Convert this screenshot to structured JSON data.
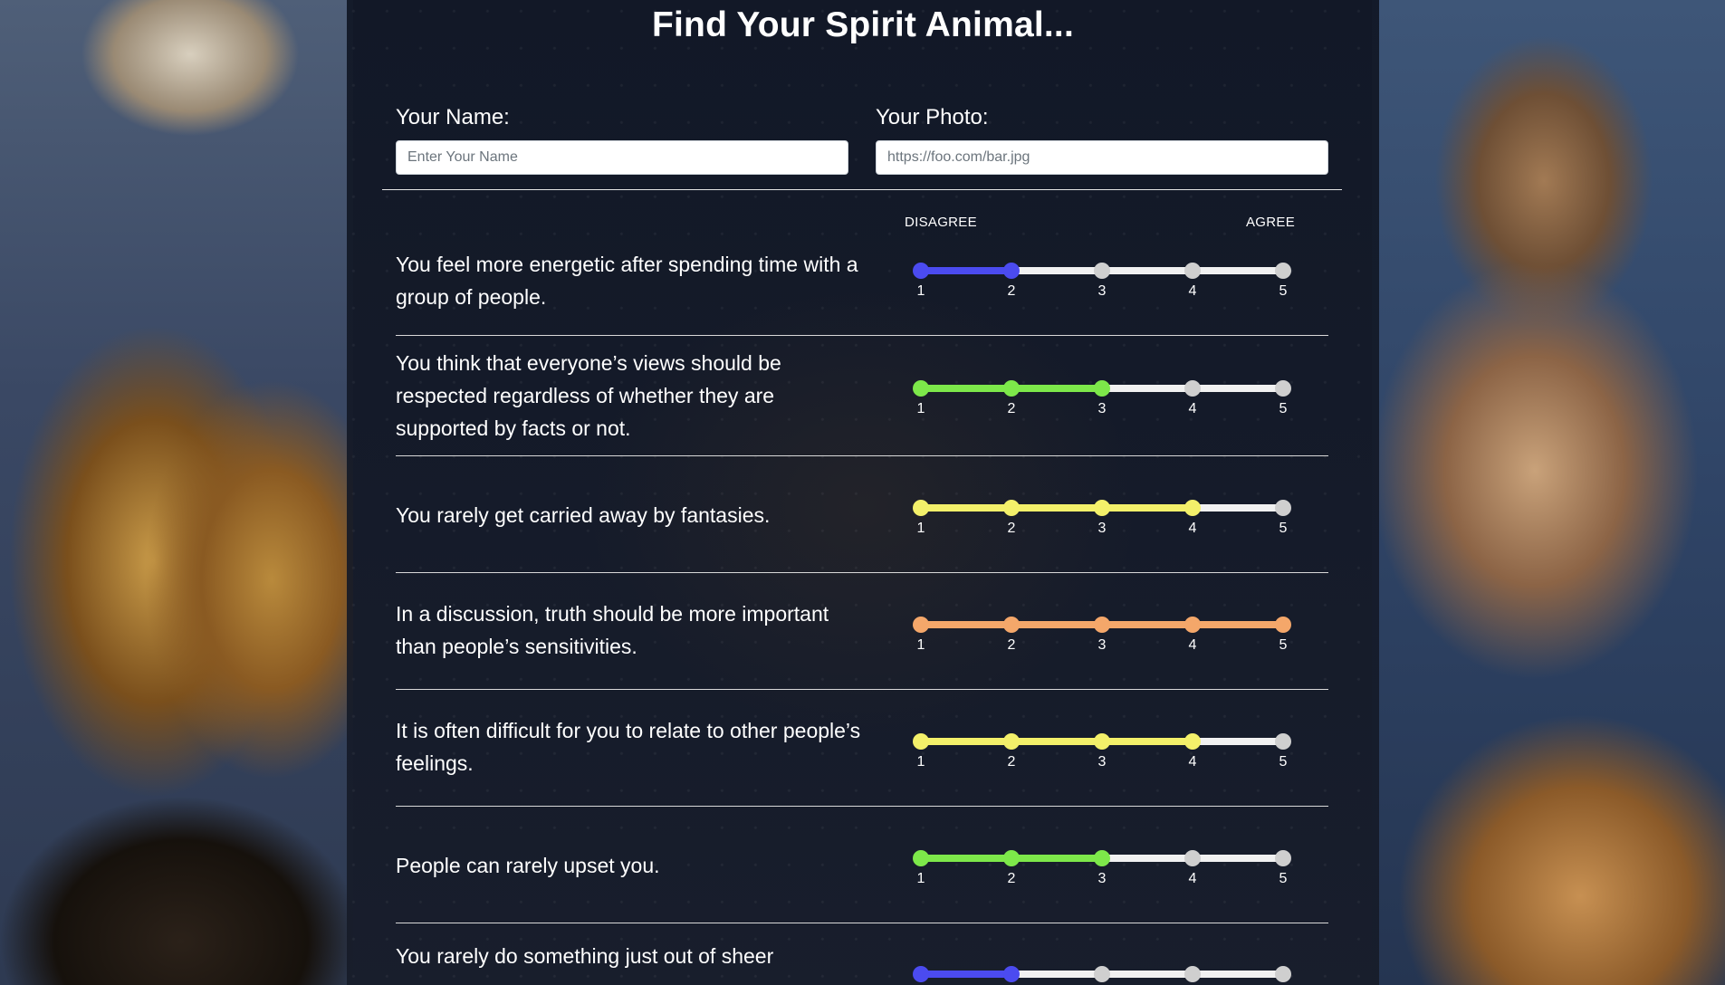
{
  "page": {
    "title": "Find Your Spirit Animal..."
  },
  "form": {
    "name_label": "Your Name:",
    "name_placeholder": "Enter Your Name",
    "name_value": "",
    "photo_label": "Your Photo:",
    "photo_placeholder": "https://foo.com/bar.jpg",
    "photo_value": ""
  },
  "scale": {
    "low_label": "DISAGREE",
    "high_label": "AGREE",
    "ticks": [
      "1",
      "2",
      "3",
      "4",
      "5"
    ]
  },
  "questions": [
    {
      "text": "You feel more energetic after spending time with a group of people.",
      "value": 2,
      "color": "#4b4bf0"
    },
    {
      "text": "You think that everyone’s views should be respected regardless of whether they are supported by facts or not.",
      "value": 3,
      "color": "#7de84a"
    },
    {
      "text": "You rarely get carried away by fantasies.",
      "value": 4,
      "color": "#f3f06a"
    },
    {
      "text": "In a discussion, truth should be more important than people’s sensitivities.",
      "value": 5,
      "color": "#f4a76a"
    },
    {
      "text": "It is often difficult for you to relate to other people’s feelings.",
      "value": 4,
      "color": "#f3f06a"
    },
    {
      "text": "People can rarely upset you.",
      "value": 3,
      "color": "#7de84a"
    },
    {
      "text": "You rarely do something just out of sheer",
      "value": 2,
      "color": "#4b4bf0"
    }
  ],
  "colors": {
    "track": "#f1f1f1",
    "inactive_dot": "#cfcfcf"
  }
}
